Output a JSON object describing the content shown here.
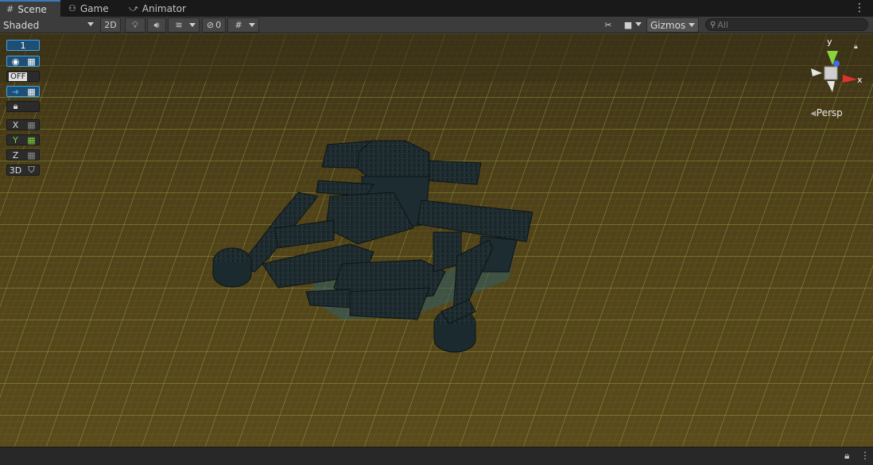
{
  "tabs": [
    {
      "label": "Scene",
      "icon": "grid-icon",
      "active": true
    },
    {
      "label": "Game",
      "icon": "gamepad-icon",
      "active": false
    },
    {
      "label": "Animator",
      "icon": "animator-icon",
      "active": false
    }
  ],
  "toolbar": {
    "shading_mode": "Shaded",
    "two_d_label": "2D",
    "hidden_count": "0",
    "gizmos_label": "Gizmos",
    "search_placeholder": "All"
  },
  "overlay": {
    "grid_size": "1",
    "off_label": "OFF",
    "axis_x": "X",
    "axis_y": "Y",
    "axis_z": "Z",
    "three_d_label": "3D"
  },
  "gizmo": {
    "y_label": "y",
    "x_label": "x",
    "projection": "Persp"
  },
  "colors": {
    "ground": "#5a4a1c",
    "grid_line": "#9bb43a",
    "accent": "#3fa5e6",
    "dungeon": "#1b2a2d"
  }
}
